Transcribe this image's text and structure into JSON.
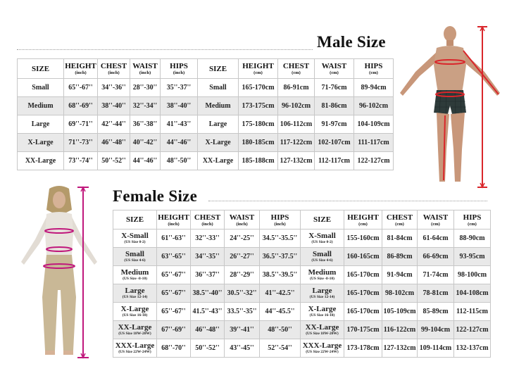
{
  "colors": {
    "male_measure": "#d9262b",
    "female_measure": "#c0187c",
    "alt_row": "#e9e9e9",
    "grid": "#c7c7c7"
  },
  "male": {
    "title": "Male Size",
    "headers": [
      {
        "main": "SIZE",
        "unit": ""
      },
      {
        "main": "HEIGHT",
        "unit": "(inch)"
      },
      {
        "main": "CHEST",
        "unit": "(inch)"
      },
      {
        "main": "WAIST",
        "unit": "(inch)"
      },
      {
        "main": "HIPS",
        "unit": "(inch)"
      },
      {
        "main": "SIZE",
        "unit": ""
      },
      {
        "main": "HEIGHT",
        "unit": "(cm)"
      },
      {
        "main": "CHEST",
        "unit": "(cm)"
      },
      {
        "main": "WAIST",
        "unit": "(cm)"
      },
      {
        "main": "HIPS",
        "unit": "(cm)"
      }
    ],
    "rows": [
      [
        "Small",
        "65''-67''",
        "34''-36''",
        "28''-30''",
        "35''-37''",
        "Small",
        "165-170cm",
        "86-91cm",
        "71-76cm",
        "89-94cm"
      ],
      [
        "Medium",
        "68''-69''",
        "38''-40''",
        "32''-34''",
        "38''-40''",
        "Medium",
        "173-175cm",
        "96-102cm",
        "81-86cm",
        "96-102cm"
      ],
      [
        "Large",
        "69''-71''",
        "42''-44''",
        "36''-38''",
        "41''-43''",
        "Large",
        "175-180cm",
        "106-112cm",
        "91-97cm",
        "104-109cm"
      ],
      [
        "X-Large",
        "71''-73''",
        "46''-48''",
        "40''-42''",
        "44''-46''",
        "X-Large",
        "180-185cm",
        "117-122cm",
        "102-107cm",
        "111-117cm"
      ],
      [
        "XX-Large",
        "73''-74''",
        "50''-52''",
        "44''-46''",
        "48''-50''",
        "XX-Large",
        "185-188cm",
        "127-132cm",
        "112-117cm",
        "122-127cm"
      ]
    ]
  },
  "female": {
    "title": "Female Size",
    "headers": [
      {
        "main": "SIZE",
        "unit": ""
      },
      {
        "main": "HEIGHT",
        "unit": "(inch)"
      },
      {
        "main": "CHEST",
        "unit": "(inch)"
      },
      {
        "main": "WAIST",
        "unit": "(inch)"
      },
      {
        "main": "HIPS",
        "unit": "(inch)"
      },
      {
        "main": "SIZE",
        "unit": ""
      },
      {
        "main": "HEIGHT",
        "unit": "(cm)"
      },
      {
        "main": "CHEST",
        "unit": "(cm)"
      },
      {
        "main": "WAIST",
        "unit": "(cm)"
      },
      {
        "main": "HIPS",
        "unit": "(cm)"
      }
    ],
    "rows": [
      {
        "size": "X-Small",
        "us": "(US Size 0-2)",
        "cells": [
          "61''-63''",
          "32''-33''",
          "24''-25''",
          "34.5''-35.5''"
        ],
        "size_cm": "X-Small",
        "us_cm": "(US Size 0-2)",
        "cells_cm": [
          "155-160cm",
          "81-84cm",
          "61-64cm",
          "88-90cm"
        ]
      },
      {
        "size": "Small",
        "us": "(US Size 4-6)",
        "cells": [
          "63''-65''",
          "34''-35''",
          "26''-27''",
          "36.5''-37.5''"
        ],
        "size_cm": "Small",
        "us_cm": "(US Size 4-6)",
        "cells_cm": [
          "160-165cm",
          "86-89cm",
          "66-69cm",
          "93-95cm"
        ]
      },
      {
        "size": "Medium",
        "us": "(US Size -8-10)",
        "cells": [
          "65''-67''",
          "36''-37''",
          "28''-29''",
          "38.5''-39.5''"
        ],
        "size_cm": "Medium",
        "us_cm": "(US Size -8-10)",
        "cells_cm": [
          "165-170cm",
          "91-94cm",
          "71-74cm",
          "98-100cm"
        ]
      },
      {
        "size": "Large",
        "us": "(US Size 12-14)",
        "cells": [
          "65''-67''",
          "38.5''-40''",
          "30.5''-32''",
          "41''-42.5''"
        ],
        "size_cm": "Large",
        "us_cm": "(US Size 12-14)",
        "cells_cm": [
          "165-170cm",
          "98-102cm",
          "78-81cm",
          "104-108cm"
        ]
      },
      {
        "size": "X-Large",
        "us": "(US Size 16-18)",
        "cells": [
          "65''-67''",
          "41.5''-43''",
          "33.5''-35''",
          "44''-45.5''"
        ],
        "size_cm": "X-Large",
        "us_cm": "(US Size 16-18)",
        "cells_cm": [
          "165-170cm",
          "105-109cm",
          "85-89cm",
          "112-115cm"
        ]
      },
      {
        "size": "XX-Large",
        "us": "(US Size 18W-20W)",
        "cells": [
          "67''-69''",
          "46''-48''",
          "39''-41''",
          "48''-50''"
        ],
        "size_cm": "XX-Large",
        "us_cm": "(US Size 18W-20W)",
        "cells_cm": [
          "170-175cm",
          "116-122cm",
          "99-104cm",
          "122-127cm"
        ]
      },
      {
        "size": "XXX-Large",
        "us": "(US Size 22W-24W)",
        "cells": [
          "68''-70''",
          "50''-52''",
          "43''-45''",
          "52''-54''"
        ],
        "size_cm": "XXX-Large",
        "us_cm": "(US Size 22W-24W)",
        "cells_cm": [
          "173-178cm",
          "127-132cm",
          "109-114cm",
          "132-137cm"
        ]
      }
    ]
  }
}
